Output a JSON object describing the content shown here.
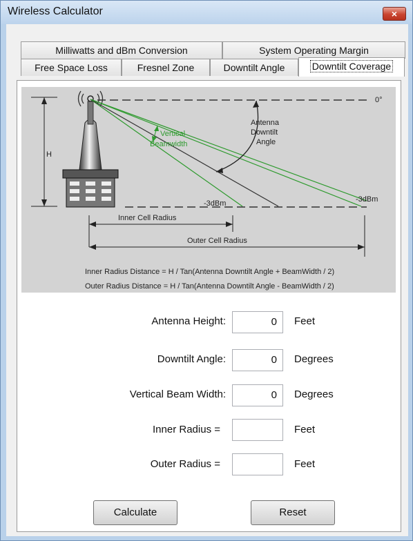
{
  "window": {
    "title": "Wireless Calculator",
    "close_glyph": "×"
  },
  "tabs": {
    "row1": [
      "Milliwatts and dBm Conversion",
      "System Operating Margin"
    ],
    "row2": [
      "Free Space Loss",
      "Fresnel Zone",
      "Downtilt Angle",
      "Downtilt Coverage"
    ],
    "active": "Downtilt Coverage"
  },
  "diagram": {
    "zero_deg": "0°",
    "h_label": "H",
    "vertical_beamwidth_line1": "Vertical",
    "vertical_beamwidth_line2": "Beamwidth",
    "antenna_downtilt_line1": "Antenna",
    "antenna_downtilt_line2": "Downtilt",
    "antenna_downtilt_line3": "Angle",
    "minus3dbm_left": "-3dBm",
    "minus3dbm_right": "-3dBm",
    "inner_cell_radius": "Inner Cell Radius",
    "outer_cell_radius": "Outer Cell Radius",
    "formula_inner": "Inner Radius Distance = H / Tan(Antenna Downtilt Angle + BeamWidth / 2)",
    "formula_outer": "Outer Radius Distance = H / Tan(Antenna Downtilt Angle - BeamWidth / 2)"
  },
  "form": {
    "antenna_height": {
      "label": "Antenna Height:",
      "value": "0",
      "unit": "Feet"
    },
    "downtilt_angle": {
      "label": "Downtilt Angle:",
      "value": "0",
      "unit": "Degrees"
    },
    "vertical_beam_width": {
      "label": "Vertical Beam Width:",
      "value": "0",
      "unit": "Degrees"
    },
    "inner_radius": {
      "label": "Inner Radius =",
      "value": "",
      "unit": "Feet"
    },
    "outer_radius": {
      "label": "Outer Radius =",
      "value": "",
      "unit": "Feet"
    }
  },
  "buttons": {
    "calculate": "Calculate",
    "reset": "Reset"
  },
  "colors": {
    "beam_green": "#2e9a2e",
    "close_red": "#c9442f"
  }
}
